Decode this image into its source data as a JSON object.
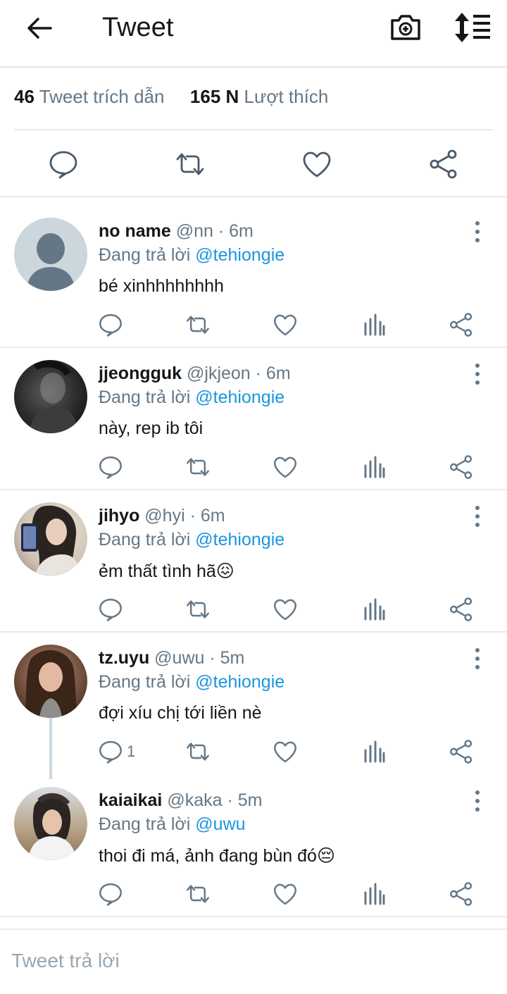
{
  "header": {
    "title": "Tweet",
    "icons": [
      "back-arrow-icon",
      "camera-plus-icon",
      "sort-order-icon"
    ]
  },
  "stats": {
    "quotes_count": "46",
    "quotes_label": "Tweet trích dẫn",
    "likes_count": "165 N",
    "likes_label": "Lượt thích"
  },
  "replies": [
    {
      "name": "no name",
      "meta": "@nn · 6m",
      "replying_prefix": "Đang trả lời",
      "replying_to": "@tehiongie",
      "text": "bé xinhhhhhhhh",
      "reply_count": ""
    },
    {
      "name": "jjeongguk",
      "meta": "@jkjeon · 6m",
      "replying_prefix": "Đang trả lời",
      "replying_to": "@tehiongie",
      "text": "này, rep ib tôi",
      "reply_count": ""
    },
    {
      "name": "jihyo",
      "meta": "@hyi · 6m",
      "replying_prefix": "Đang trả lời",
      "replying_to": "@tehiongie",
      "text": "ẻm thất tình hã",
      "emoji": "😖",
      "reply_count": ""
    },
    {
      "name": "tz.uyu",
      "meta": "@uwu · 5m",
      "replying_prefix": "Đang trả lời",
      "replying_to": "@tehiongie",
      "text": "đợi xíu chị tới liền nè",
      "reply_count": "1"
    },
    {
      "name": "kaiaikai",
      "meta": "@kaka · 5m",
      "replying_prefix": "Đang trả lời",
      "replying_to": "@uwu",
      "text": "thoi đi má, ảnh đang bùn đó",
      "emoji": "😔",
      "reply_count": ""
    }
  ],
  "compose": {
    "placeholder": "Tweet trả lời"
  },
  "colors": {
    "accent": "#1b95e0",
    "icon": "#657786",
    "text": "#14171a",
    "divider": "#e8eaec"
  }
}
